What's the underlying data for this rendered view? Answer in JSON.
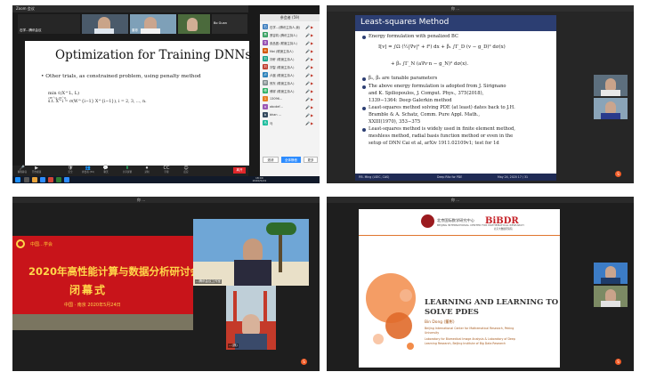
{
  "q1": {
    "title_bar": "Zoom 会议",
    "gallery": [
      {
        "name": "石学…腾讯会议"
      },
      {
        "name": ""
      },
      {
        "name": "董彬"
      },
      {
        "name": ""
      },
      {
        "name": "Bo Guan"
      }
    ],
    "slide": {
      "title": "Optimization for Training DNNs",
      "bullet": "Other trials, as constrained problem, using penalty method",
      "eq1": "min  ℓ(X^L, L)",
      "eq1_sub": "{W^i},{X^i}",
      "eq2": "s.t.  X^i = σ(W^{i−1} X^{i−1}),  i = 2, 3, ..., n."
    },
    "toolbar": [
      {
        "icon": "🎤",
        "label": "解除静音"
      },
      {
        "icon": "▶",
        "label": "开启视频"
      },
      {
        "icon": "🛡",
        "label": "安全"
      },
      {
        "icon": "👥",
        "label": "参会者 (59)"
      },
      {
        "icon": "💬",
        "label": "聊天"
      },
      {
        "icon": "⬆",
        "label": "共享屏幕"
      },
      {
        "icon": "⏺",
        "label": "录制"
      },
      {
        "icon": "CC",
        "label": "字幕"
      },
      {
        "icon": "☺",
        "label": "反应"
      }
    ],
    "leave": "离开",
    "taskbar_time": "18:00",
    "taskbar_date": "2020/5/24",
    "participants_title": "参会者 (59)",
    "participants": [
      {
        "initial": "石",
        "name": "石学…(腾讯主持人,我)",
        "color": "#3d7ebf"
      },
      {
        "initial": "萧",
        "name": "萧容钧 (腾讯主持人)",
        "color": "#2e9c5a"
      },
      {
        "initial": "张",
        "name": "张品昌 (联席主持人)",
        "color": "#8e44ad"
      },
      {
        "initial": "M",
        "name": "Mei (联席主持人)",
        "color": "#d35400"
      },
      {
        "initial": "刘",
        "name": "刘轩 (联席主持人)",
        "color": "#16a085"
      },
      {
        "initial": "刘",
        "name": "刘智 (联席主持人)",
        "color": "#c0392b"
      },
      {
        "initial": "卢",
        "name": "卢晨 (联席主持人)",
        "color": "#2980b9"
      },
      {
        "initial": "邢",
        "name": "邢东 (联席主持人)",
        "color": "#7f8c8d"
      },
      {
        "initial": "傅",
        "name": "傅祥 (联席主持人)",
        "color": "#27ae60"
      },
      {
        "initial": "1",
        "name": "13096…",
        "color": "#e67e22"
      },
      {
        "initial": "a",
        "name": "abcdef…",
        "color": "#9b59b6"
      },
      {
        "initial": "b",
        "name": "bhan …",
        "color": "#34495e"
      },
      {
        "initial": "马",
        "name": "马",
        "color": "#1abc9c"
      }
    ],
    "panel_buttons": [
      "邀请",
      "全体静音",
      "更多"
    ]
  },
  "q2": {
    "top_label": "你 …",
    "slide": {
      "title": "Least-squares Method",
      "b1": "Energy formulation with penalized BC",
      "eq1": "I[v] = ∫Ω (½|∇v|² + f²) dx + β₁ ∫Γ_D (v − g_D)² dσ(x)",
      "eq2": "+ β₂ ∫Γ_N (a∇v·n − g_N)² dσ(x).",
      "b2": "β₁, β₂ are tunable parameters",
      "b3": "The above energy formulation is adopted from J. Sirignano",
      "b3b": "and K. Spiliopoulos, J. Comput. Phys., 375(2018),",
      "b3c": "1339−1364: Deep Galerkin method",
      "b4": "Least-squares method solving PDE (at least) dates back to J.H.",
      "b4b": "Bramble & A. Schatz, Comm. Pure Appl. Math.,",
      "b4c": "XXIII(1970), 353−375",
      "b5": "Least-squares method is widely used in finite element method,",
      "b5b": "meshless method, radial basis function method or even in the",
      "b5c": "setup of DNN Cai et al, arXiv 1911.02109v1; test for 1d",
      "foot_left": "P.B. Ming (LSEC, CAS)",
      "foot_mid": "Deep Ritz for PDE",
      "foot_right": "May 24, 2020   17 / 31"
    },
    "cam_labels": [
      "…",
      "…"
    ]
  },
  "q3": {
    "top_label": "你 …",
    "banner": {
      "org": "中国…学会",
      "main": "2020年高性能计算与数据分析研讨会",
      "sub": "闭幕式",
      "date": "中国 · 南京  2020年5月24日"
    },
    "tile1_label": "…(你)",
    "tile2_label": "…腾讯会议工作室",
    "tile3_label": "…(我)"
  },
  "q4": {
    "top_label": "你 …",
    "slide": {
      "inst": "北京国际数学研究中心",
      "inst2": "BEIJING INTERNATIONAL CENTER FOR MATHEMATICAL RESEARCH",
      "logo": "BiBDR",
      "logo2": "北京大数据研究院",
      "title": "LEARNING AND LEARNING TO",
      "title2": "SOLVE PDES",
      "author": "Bin Dong (董彬)",
      "aff1": "Beijing International Center for Mathematical Research, Peking",
      "aff2": "University",
      "aff3": "Laboratory for Biomedical Image Analysis & Laboratory of Deep",
      "aff4": "Learning Research, Beijing Institute of Big Data Research"
    },
    "cam_labels": [
      "…",
      "…"
    ]
  },
  "colors": {
    "beamer_blue": "#2c3e72",
    "zoom_blue": "#2d8cff",
    "leave_red": "#e0262a",
    "banner_red": "#c8141a",
    "banner_gold": "#ffd84a",
    "accent_orange": "#e0762e"
  }
}
